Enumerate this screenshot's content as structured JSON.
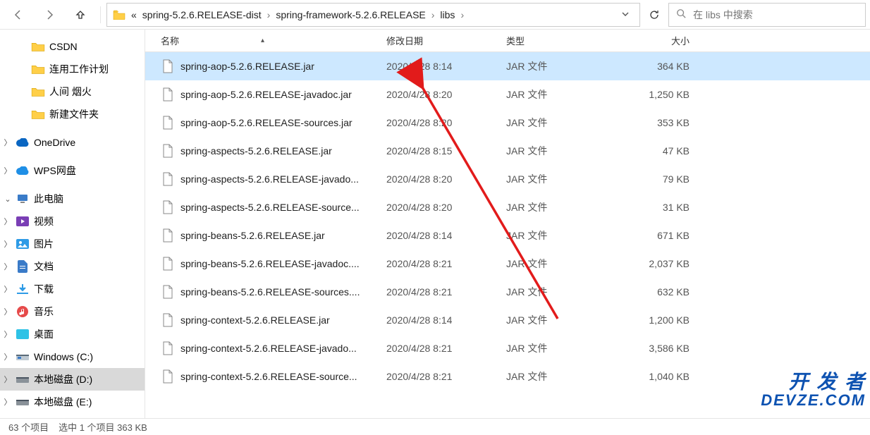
{
  "breadcrumb": {
    "ellipsis": "«",
    "seg1": "spring-5.2.6.RELEASE-dist",
    "seg2": "spring-framework-5.2.6.RELEASE",
    "seg3": "libs",
    "sep": "›"
  },
  "search": {
    "placeholder": "在 libs 中搜索"
  },
  "nav": {
    "csdn": "CSDN",
    "lianyong": "连用工作计划",
    "renjian": "人间 烟火",
    "xinjian": "新建文件夹",
    "onedrive": "OneDrive",
    "wps": "WPS网盘",
    "thispc": "此电脑",
    "video": "视频",
    "pictures": "图片",
    "docs": "文档",
    "downloads": "下载",
    "music": "音乐",
    "desktop": "桌面",
    "drivec": "Windows (C:)",
    "drived": "本地磁盘 (D:)",
    "drivee": "本地磁盘 (E:)"
  },
  "columns": {
    "name": "名称",
    "date": "修改日期",
    "type": "类型",
    "size": "大小"
  },
  "files": [
    {
      "name": "spring-aop-5.2.6.RELEASE.jar",
      "date": "2020/4/28 8:14",
      "type": "JAR 文件",
      "size": "364 KB",
      "sel": true
    },
    {
      "name": "spring-aop-5.2.6.RELEASE-javadoc.jar",
      "date": "2020/4/28 8:20",
      "type": "JAR 文件",
      "size": "1,250 KB",
      "sel": false
    },
    {
      "name": "spring-aop-5.2.6.RELEASE-sources.jar",
      "date": "2020/4/28 8:20",
      "type": "JAR 文件",
      "size": "353 KB",
      "sel": false
    },
    {
      "name": "spring-aspects-5.2.6.RELEASE.jar",
      "date": "2020/4/28 8:15",
      "type": "JAR 文件",
      "size": "47 KB",
      "sel": false
    },
    {
      "name": "spring-aspects-5.2.6.RELEASE-javado...",
      "date": "2020/4/28 8:20",
      "type": "JAR 文件",
      "size": "79 KB",
      "sel": false
    },
    {
      "name": "spring-aspects-5.2.6.RELEASE-source...",
      "date": "2020/4/28 8:20",
      "type": "JAR 文件",
      "size": "31 KB",
      "sel": false
    },
    {
      "name": "spring-beans-5.2.6.RELEASE.jar",
      "date": "2020/4/28 8:14",
      "type": "JAR 文件",
      "size": "671 KB",
      "sel": false
    },
    {
      "name": "spring-beans-5.2.6.RELEASE-javadoc....",
      "date": "2020/4/28 8:21",
      "type": "JAR 文件",
      "size": "2,037 KB",
      "sel": false
    },
    {
      "name": "spring-beans-5.2.6.RELEASE-sources....",
      "date": "2020/4/28 8:21",
      "type": "JAR 文件",
      "size": "632 KB",
      "sel": false
    },
    {
      "name": "spring-context-5.2.6.RELEASE.jar",
      "date": "2020/4/28 8:14",
      "type": "JAR 文件",
      "size": "1,200 KB",
      "sel": false
    },
    {
      "name": "spring-context-5.2.6.RELEASE-javado...",
      "date": "2020/4/28 8:21",
      "type": "JAR 文件",
      "size": "3,586 KB",
      "sel": false
    },
    {
      "name": "spring-context-5.2.6.RELEASE-source...",
      "date": "2020/4/28 8:21",
      "type": "JAR 文件",
      "size": "1,040 KB",
      "sel": false
    }
  ],
  "status": {
    "count": "63 个项目",
    "selection": "选中 1 个项目 363 KB"
  },
  "watermark": {
    "l1": "开 发 者",
    "l2": "DEVZE.COM"
  }
}
